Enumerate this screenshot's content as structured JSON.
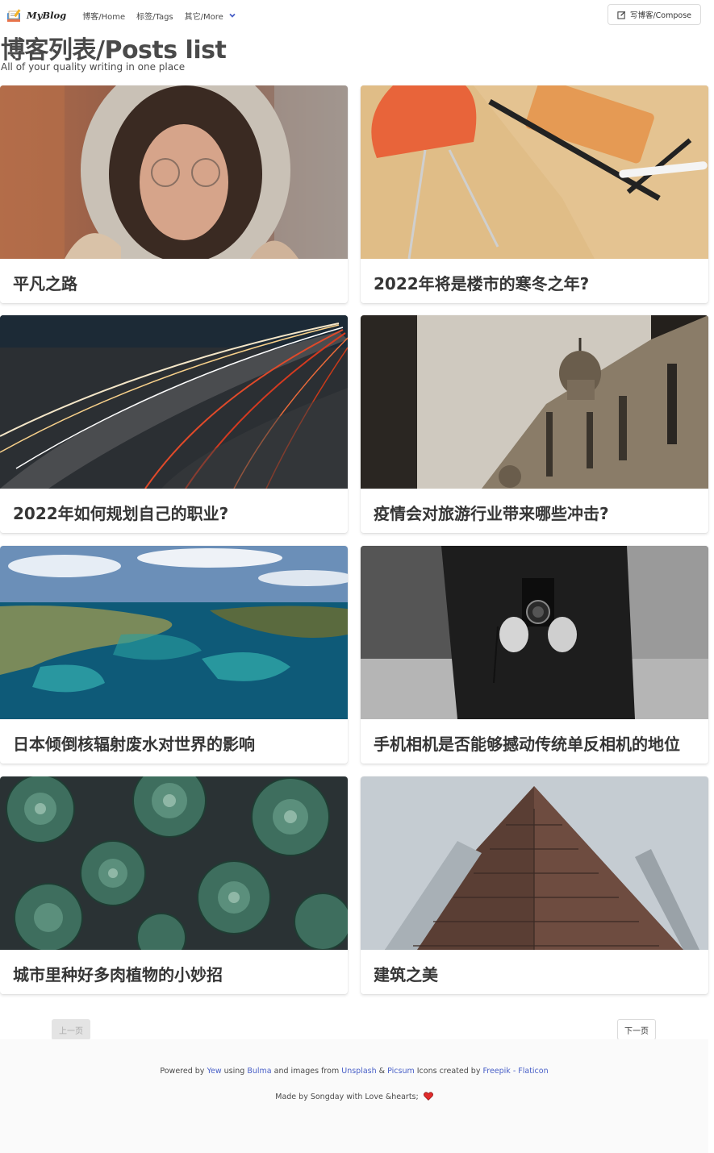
{
  "navbar": {
    "brand": "MyBlog",
    "items": [
      "博客/Home",
      "标签/Tags",
      "其它/More"
    ],
    "compose": "写博客/Compose"
  },
  "header": {
    "title": "博客列表/Posts list",
    "subtitle": "All of your quality writing in one place"
  },
  "posts": [
    {
      "title": "平凡之路",
      "image": "woman-hood"
    },
    {
      "title": "2022年将是楼市的寒冬之年?",
      "image": "desk-chair"
    },
    {
      "title": "2022年如何规划自己的职业?",
      "image": "light-trails"
    },
    {
      "title": "疫情会对旅游行业带来哪些冲击?",
      "image": "building-dome"
    },
    {
      "title": "日本倾倒核辐射废水对世界的影响",
      "image": "coastline-aerial"
    },
    {
      "title": "手机相机是否能够撼动传统单反相机的地位",
      "image": "vintage-camera"
    },
    {
      "title": "城市里种好多肉植物的小妙招",
      "image": "succulents"
    },
    {
      "title": "建筑之美",
      "image": "skyscraper"
    }
  ],
  "pagination": {
    "prev": "上一页",
    "next": "下一页"
  },
  "footer": {
    "powered": "Powered by",
    "yew": "Yew",
    "using": "using",
    "bulma": "Bulma",
    "and_images": "and images from",
    "unsplash": "Unsplash",
    "amp": "&",
    "picsum": "Picsum",
    "icons_created": "Icons created by",
    "freepik": "Freepik - Flaticon",
    "made_by": "Made by Songday with Love &hearts;"
  },
  "colors": {
    "link": "#485fc7",
    "heart": "#e02b2b",
    "footer_bg": "#fafafa"
  }
}
